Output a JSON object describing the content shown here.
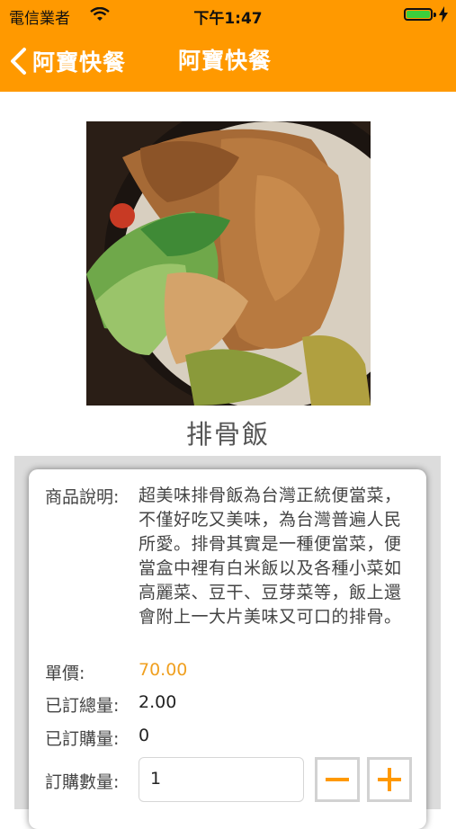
{
  "status_bar": {
    "carrier": "電信業者",
    "time": "下午1:47"
  },
  "nav": {
    "back_label": "阿寶快餐",
    "title": "阿寶快餐"
  },
  "product": {
    "name": "排骨飯",
    "description_label": "商品說明:",
    "description": "超美味排骨飯為台灣正統便當菜，不僅好吃又美味，為台灣普遍人民所愛。排骨其實是一種便當菜，便當盒中裡有白米飯以及各種小菜如高麗菜、豆干、豆芽菜等，飯上還會附上一大片美味又可口的排骨。",
    "price_label": "單價:",
    "price": "70.00",
    "total_ordered_label": "已訂總量:",
    "total_ordered": "2.00",
    "ordered_label": "已訂購量:",
    "ordered": "0",
    "quantity_label": "訂購數量:",
    "quantity": "1"
  },
  "colors": {
    "accent": "#ff9900",
    "price": "#f0a020"
  },
  "icons": {
    "back": "chevron-left-icon",
    "minus": "minus-icon",
    "plus": "plus-icon",
    "wifi": "wifi-icon",
    "battery": "battery-icon",
    "charging": "bolt-icon"
  }
}
